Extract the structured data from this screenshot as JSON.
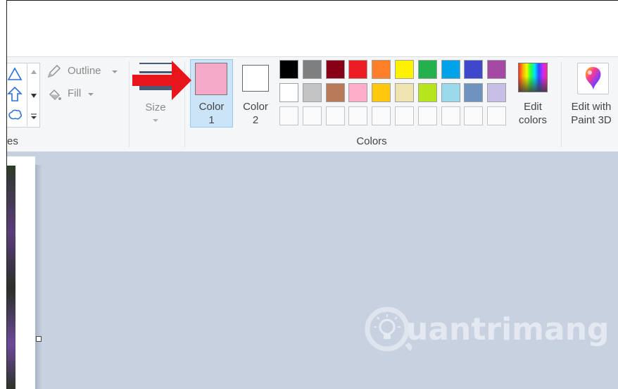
{
  "ribbon": {
    "shapes_group_label": "es",
    "outline_label": "Outline",
    "fill_label": "Fill",
    "size_label": "Size",
    "color1_label_line1": "Color",
    "color1_label_line2": "1",
    "color2_label_line1": "Color",
    "color2_label_line2": "2",
    "colors_group_label": "Colors",
    "edit_colors_line1": "Edit",
    "edit_colors_line2": "colors",
    "edit_paint3d_line1": "Edit with",
    "edit_paint3d_line2": "Paint 3D"
  },
  "colors": {
    "color1": "#f4a9c7",
    "color2": "#ffffff",
    "palette_row1": [
      "#000000",
      "#7f7f7f",
      "#880015",
      "#ed1c24",
      "#ff7f27",
      "#fff200",
      "#22b14c",
      "#00a2e8",
      "#3f48cc",
      "#a349a4"
    ],
    "palette_row2": [
      "#ffffff",
      "#c3c3c3",
      "#b97a57",
      "#ffaec9",
      "#ffc90e",
      "#efe4b0",
      "#b5e61d",
      "#99d9ea",
      "#7092be",
      "#c8bfe7"
    ],
    "arrow": "#e8151b"
  },
  "watermark": {
    "text": "uantrimang"
  }
}
